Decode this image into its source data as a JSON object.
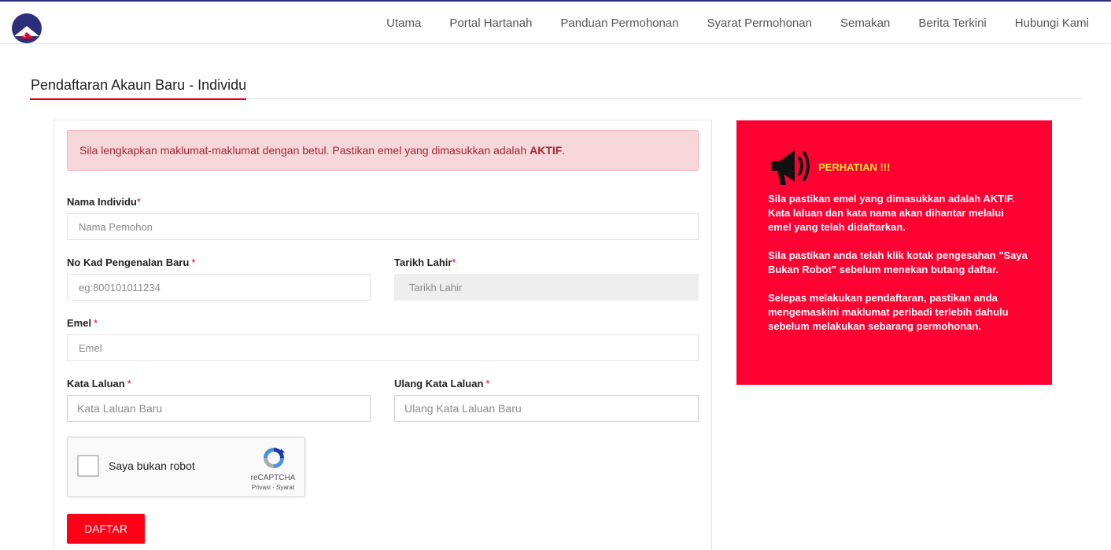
{
  "nav": {
    "items": [
      "Utama",
      "Portal Hartanah",
      "Panduan Permohonan",
      "Syarat Permohonan",
      "Semakan",
      "Berita Terkini",
      "Hubungi Kami"
    ]
  },
  "page": {
    "title": "Pendaftaran Akaun Baru - Individu"
  },
  "alert": {
    "text": "Sila lengkapkan maklumat-maklumat dengan betul. Pastikan emel yang dimasukkan adalah",
    "emphasis": "AKTIF",
    "suffix": "."
  },
  "form": {
    "required_mark": "*",
    "nama": {
      "label": "Nama Individu",
      "placeholder": "Nama Pemohon",
      "value": ""
    },
    "ic": {
      "label": "No Kad Pengenalan Baru",
      "placeholder": "eg:800101011234",
      "value": ""
    },
    "dob": {
      "label": "Tarikh Lahir",
      "placeholder": "Tarikh Lahir",
      "value": ""
    },
    "emel": {
      "label": "Emel",
      "placeholder": "Emel",
      "value": ""
    },
    "password": {
      "label": "Kata Laluan",
      "placeholder": "Kata Laluan Baru",
      "value": ""
    },
    "password_confirm": {
      "label": "Ulang Kata Laluan",
      "placeholder": "Ulang Kata Laluan Baru",
      "value": ""
    },
    "submit_label": "DAFTAR"
  },
  "captcha": {
    "label": "Saya bukan robot",
    "brand": "reCAPTCHA",
    "links": "Privasi - Syarat",
    "checked": false
  },
  "notice": {
    "heading": "PERHATIAN !!!",
    "paragraphs": [
      "Sila pastikan emel yang dimasukkan adalah AKTIF. Kata laluan dan kata nama akan dihantar melalui emel yang telah didaftarkan.",
      "Sila pastikan anda telah klik kotak pengesahan \"Saya Bukan Robot\" sebelum menekan butang daftar.",
      "Selepas melakukan pendaftaran, pastikan anda mengemaskini maklumat peribadi terlebih dahulu sebelum melakukan sebarang permohonan."
    ]
  },
  "colors": {
    "accent_red": "#ff0016",
    "notice_bg": "#ff0033",
    "notice_heading": "#ffeb3b",
    "alert_bg": "#f8d7da",
    "alert_text": "#a12734",
    "nav_text": "#555555",
    "top_line": "#2b2f7a"
  },
  "icons": {
    "logo": "house-flag-logo",
    "notice": "megaphone-icon",
    "captcha": "recaptcha-logo"
  }
}
